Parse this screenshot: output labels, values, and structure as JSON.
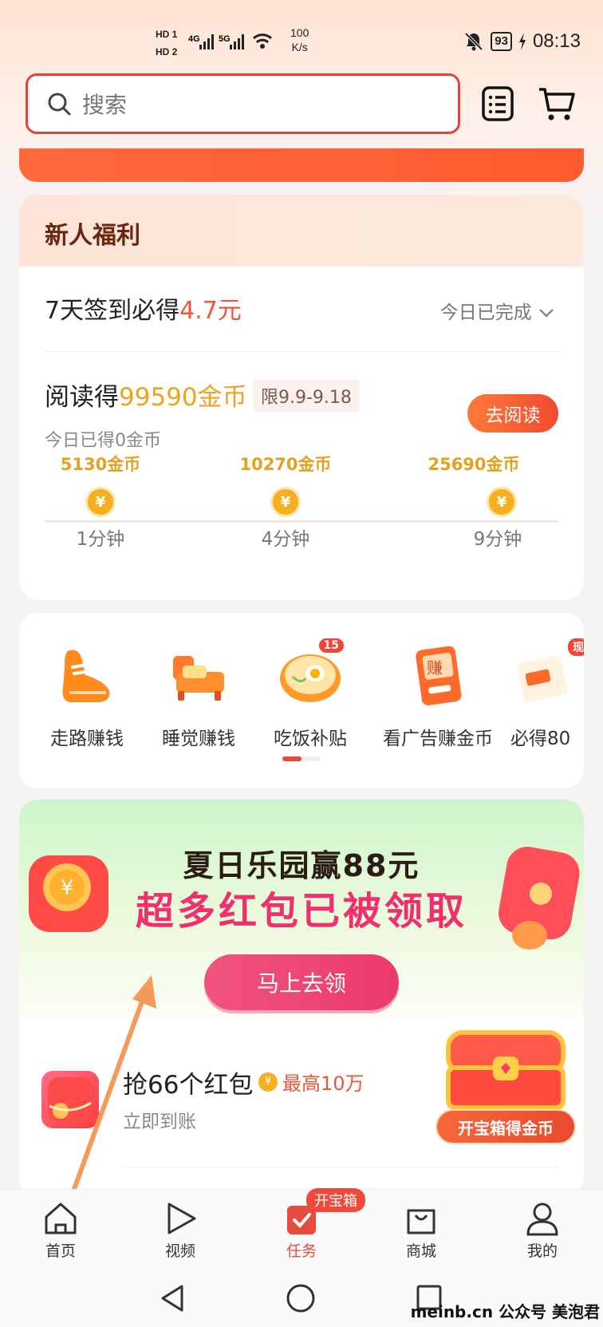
{
  "status_bar": {
    "hd1": "HD 1",
    "hd2": "HD 2",
    "signal1": "4G",
    "signal2": "5G",
    "speed_value": "100",
    "speed_unit": "K/s",
    "battery": "93",
    "time": "08:13"
  },
  "search": {
    "placeholder": "搜索"
  },
  "newbie": {
    "title": "新人福利",
    "sign_text": "7天签到必得",
    "sign_amount": "4.7元",
    "sign_status": "今日已完成",
    "read_prefix": "阅读得",
    "read_coins": "99590金币",
    "read_limit": "限9.9-9.18",
    "read_today": "今日已得0金币",
    "read_button": "去阅读",
    "milestones": [
      {
        "coins": "5130金币",
        "time": "1分钟",
        "symbol": "¥"
      },
      {
        "coins": "10270金币",
        "time": "4分钟",
        "symbol": "¥"
      },
      {
        "coins": "25690金币",
        "time": "9分钟",
        "symbol": "¥"
      }
    ]
  },
  "features": [
    {
      "label": "走路赚钱",
      "icon": "shoe-icon"
    },
    {
      "label": "睡觉赚钱",
      "icon": "bed-icon"
    },
    {
      "label": "吃饭补贴",
      "icon": "bowl-icon",
      "badge": "15"
    },
    {
      "label": "看广告赚金币",
      "icon": "ad-book-icon",
      "glyph": "赚"
    },
    {
      "label": "必得80",
      "icon": "cash-icon",
      "badge": "现"
    }
  ],
  "banner": {
    "title": "夏日乐园赢88元",
    "subtitle": "超多红包已被领取",
    "button": "马上去领"
  },
  "redpacket": {
    "title": "抢66个红包",
    "max_label": "最高10万",
    "coin_symbol": "¥",
    "sub": "立即到账",
    "chest_button": "开宝箱得金币"
  },
  "bottom_nav": [
    {
      "label": "首页",
      "icon": "home-icon"
    },
    {
      "label": "视频",
      "icon": "play-icon"
    },
    {
      "label": "任务",
      "icon": "task-icon",
      "badge": "开宝箱",
      "active": true
    },
    {
      "label": "商城",
      "icon": "shop-bag-icon"
    },
    {
      "label": "我的",
      "icon": "profile-icon"
    }
  ],
  "watermark": "meinb.cn  公众号 美泡君",
  "colors": {
    "accent": "#e84a3e",
    "coin": "#f0a21e",
    "banner_pink": "#ef2f6e",
    "banner_green": "#cdf5cc"
  }
}
